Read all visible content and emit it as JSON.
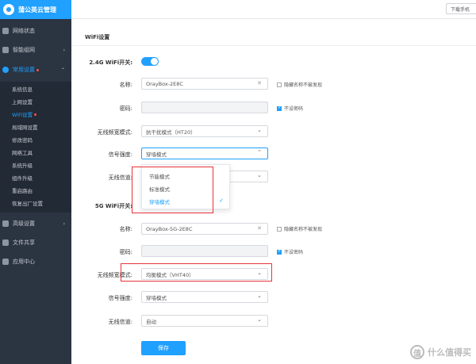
{
  "app": {
    "title": "蒲公英云管理"
  },
  "topbar": {
    "download_label": "下载手机"
  },
  "sidebar": {
    "items": [
      {
        "label": "网络状态",
        "icon": "network-status-icon"
      },
      {
        "label": "智能组网",
        "icon": "smart-network-icon"
      },
      {
        "label": "常用设置",
        "icon": "gear-icon"
      },
      {
        "label": "高级设置",
        "icon": "advanced-settings-icon"
      },
      {
        "label": "文件共享",
        "icon": "file-share-icon"
      },
      {
        "label": "应用中心",
        "icon": "app-center-icon"
      }
    ],
    "submenu": [
      "系统信息",
      "上网设置",
      "WiFi设置",
      "局域网设置",
      "修改密码",
      "网络工具",
      "系统升级",
      "组件升级",
      "重启路由",
      "恢复出厂设置"
    ]
  },
  "page": {
    "title": "WiFi设置",
    "wifi24": {
      "toggle_label": "2.4G WiFi开关:",
      "name_label": "名称:",
      "name_value": "OrayBox-2E8C",
      "hide_label": "隐藏名称不被发现",
      "password_label": "密码:",
      "no_password_label": "不设密码",
      "bandwidth_label": "无线频宽模式:",
      "bandwidth_value": "抗干扰模式（HT20）",
      "signal_label": "信号强度:",
      "signal_value": "穿墙模式",
      "channel_label": "无线信道:",
      "signal_options": [
        "节能模式",
        "标准模式",
        "穿墙模式"
      ]
    },
    "wifi5": {
      "toggle_label": "5G WiFi开关:",
      "name_label": "名称:",
      "name_value": "OrayBox-5G-2E8C",
      "hide_label": "隐藏名称不被发现",
      "password_label": "密码:",
      "no_password_label": "不设密码",
      "bandwidth_label": "无线频宽模式:",
      "bandwidth_value": "均衡模式（VHT40）",
      "signal_label": "信号强度:",
      "signal_value": "穿墙模式",
      "channel_label": "无线信道:",
      "channel_value": "自动"
    },
    "save_label": "保存"
  },
  "watermark": {
    "text": "什么值得买",
    "icon": "值"
  },
  "colors": {
    "accent": "#20a0ff",
    "sidebar_bg": "#2b3441",
    "highlight_box": "#e8333a"
  }
}
